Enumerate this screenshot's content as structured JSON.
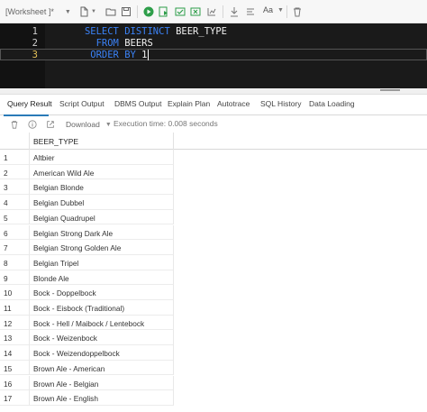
{
  "toolbar": {
    "worksheet_label": "[Worksheet ]*",
    "font_label": "Aa",
    "icons": [
      "new-file-icon",
      "open-folder-icon",
      "save-icon",
      "run-statement-icon",
      "run-script-icon",
      "commit-icon",
      "rollback-icon",
      "explain-plan-icon",
      "autotrace-icon",
      "download-icon",
      "upload-icon",
      "format-icon",
      "font-icon",
      "delete-icon"
    ]
  },
  "editor": {
    "lines": [
      {
        "num": "1",
        "tokens": [
          {
            "t": "SELECT DISTINCT ",
            "c": "kw"
          },
          {
            "t": "BEER_TYPE",
            "c": "id"
          }
        ]
      },
      {
        "num": "2",
        "tokens": [
          {
            "t": "  FROM ",
            "c": "kw"
          },
          {
            "t": "BEERS",
            "c": "id"
          }
        ]
      },
      {
        "num": "3",
        "tokens": [
          {
            "t": " ORDER BY ",
            "c": "kw"
          },
          {
            "t": "1",
            "c": "num"
          }
        ]
      }
    ]
  },
  "tabs": [
    "Query Result",
    "Script Output",
    "DBMS Output",
    "Explain Plan",
    "Autotrace",
    "SQL History",
    "Data Loading"
  ],
  "result_toolbar": {
    "download_label": "Download",
    "execution_time": "Execution time: 0.008 seconds"
  },
  "grid": {
    "columns": [
      "BEER_TYPE"
    ],
    "rows": [
      {
        "n": "1",
        "v": "Altbier"
      },
      {
        "n": "2",
        "v": "American Wild Ale"
      },
      {
        "n": "3",
        "v": "Belgian Blonde"
      },
      {
        "n": "4",
        "v": "Belgian Dubbel"
      },
      {
        "n": "5",
        "v": "Belgian Quadrupel"
      },
      {
        "n": "6",
        "v": "Belgian Strong Dark Ale"
      },
      {
        "n": "7",
        "v": "Belgian Strong Golden Ale"
      },
      {
        "n": "8",
        "v": "Belgian Tripel"
      },
      {
        "n": "9",
        "v": "Blonde Ale"
      },
      {
        "n": "10",
        "v": "Bock - Doppelbock"
      },
      {
        "n": "11",
        "v": "Bock - Eisbock (Traditional)"
      },
      {
        "n": "12",
        "v": "Bock - Hell / Maibock / Lentebock"
      },
      {
        "n": "13",
        "v": "Bock - Weizenbock"
      },
      {
        "n": "14",
        "v": "Bock - Weizendoppelbock"
      },
      {
        "n": "15",
        "v": "Brown Ale - American"
      },
      {
        "n": "16",
        "v": "Brown Ale - Belgian"
      },
      {
        "n": "17",
        "v": "Brown Ale - English"
      }
    ]
  },
  "colors": {
    "editor_bg": "#1a1a1a",
    "keyword": "#3b82f6",
    "active_line_number": "#e8c45a",
    "tab_underline": "#2a7ab8",
    "run_green": "#2e9e4a"
  }
}
